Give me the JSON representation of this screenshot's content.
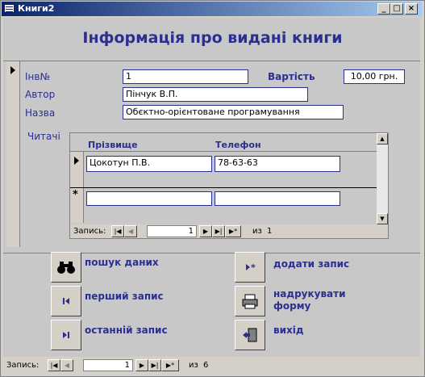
{
  "window": {
    "title": "Книги2",
    "btn_min": "_",
    "btn_max": "□",
    "btn_close": "×"
  },
  "form": {
    "heading": "Інформація про видані книги",
    "fields": {
      "inv_label": "Інв№",
      "inv_value": "1",
      "price_label": "Вартість",
      "price_value": "10,00 грн.",
      "author_label": "Автор",
      "author_value": "Пінчук В.П.",
      "title_label": "Назва",
      "title_value": "Обєктно-орієнтоване програмування"
    },
    "readers_label": "Читачі",
    "subform": {
      "col_surname": "Прізвище",
      "col_phone": "Телефон",
      "rows": [
        {
          "surname": "Цокотун П.В.",
          "phone": "78-63-63"
        }
      ],
      "new_row_marker": "*",
      "nav": {
        "label": "Запись:",
        "current": "1",
        "of_label": "из",
        "total": "1"
      }
    },
    "buttons": {
      "search": "пошук даних",
      "add": "додати запис",
      "first": "перший запис",
      "print": "надрукувати форму",
      "last": "останній запис",
      "exit": "вихід"
    }
  },
  "main_nav": {
    "label": "Запись:",
    "current": "1",
    "of_label": "из",
    "total": "6"
  }
}
